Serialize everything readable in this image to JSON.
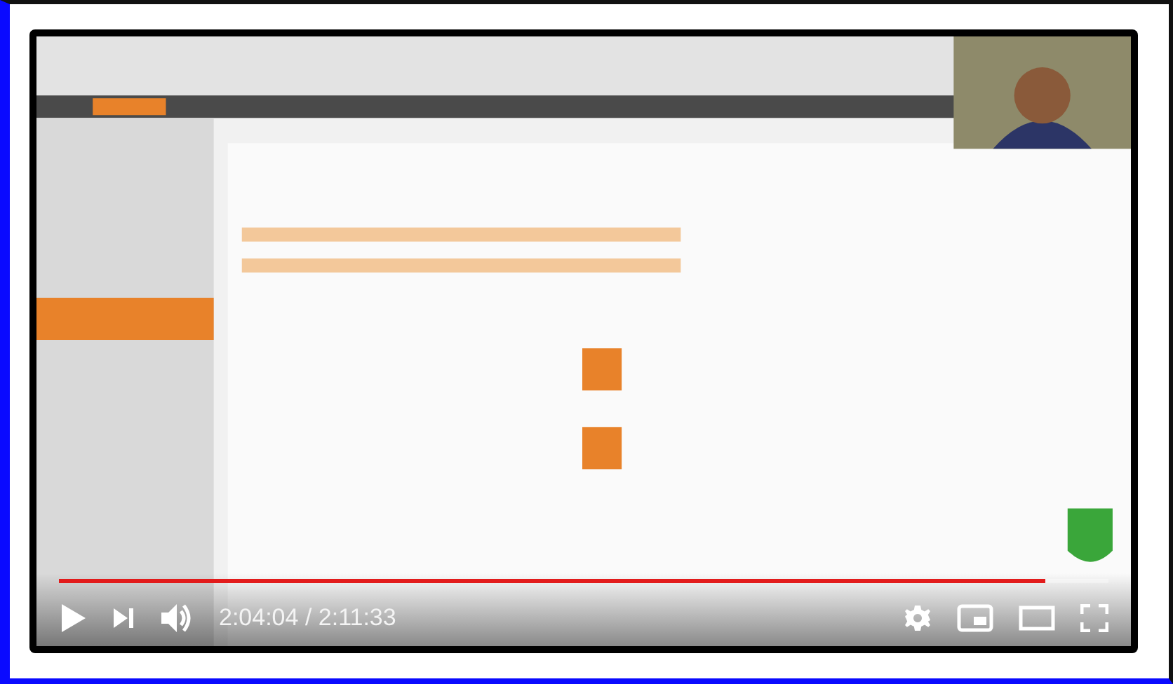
{
  "player": {
    "progress": {
      "level": 0.94
    },
    "time": "2:04:04 / 2:11:33"
  }
}
